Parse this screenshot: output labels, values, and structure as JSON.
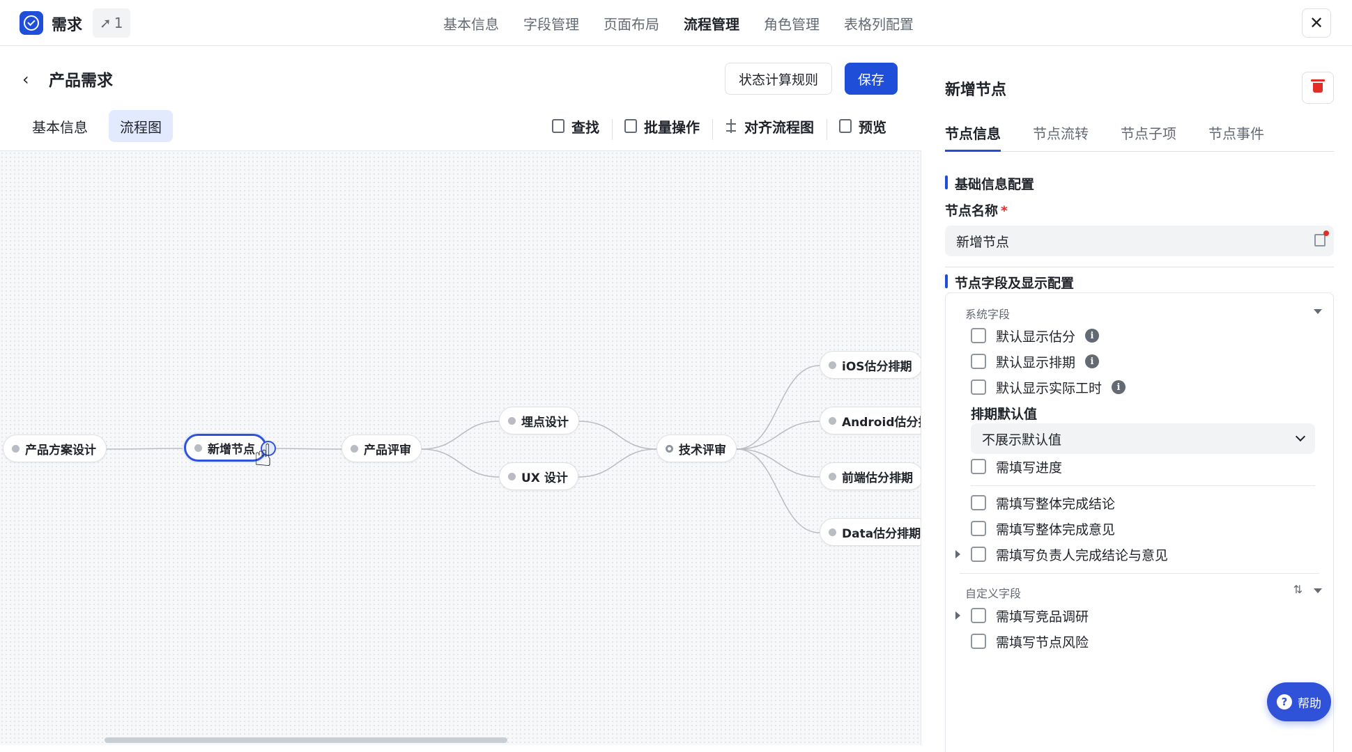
{
  "app": {
    "title": "需求",
    "badge": "1",
    "badge_icon": "pin-icon",
    "accent": "#1f4fd8"
  },
  "top_nav": [
    {
      "label": "基本信息",
      "active": false
    },
    {
      "label": "字段管理",
      "active": false
    },
    {
      "label": "页面布局",
      "active": false
    },
    {
      "label": "流程管理",
      "active": true
    },
    {
      "label": "角色管理",
      "active": false
    },
    {
      "label": "表格列配置",
      "active": false
    }
  ],
  "header": {
    "title": "产品需求",
    "rules_button": "状态计算规则",
    "save_button": "保存",
    "tabs": [
      {
        "label": "基本信息",
        "active": false
      },
      {
        "label": "流程图",
        "active": true
      }
    ],
    "toolbar": [
      {
        "label": "查找",
        "icon": "find-icon"
      },
      {
        "label": "批量操作",
        "icon": "batch-icon"
      },
      {
        "label": "对齐流程图",
        "icon": "align-icon"
      },
      {
        "label": "预览",
        "icon": "preview-icon"
      }
    ]
  },
  "flow": {
    "nodes": [
      {
        "id": "n1",
        "label": "产品方案设计"
      },
      {
        "id": "n2",
        "label": "新增节点",
        "selected": true
      },
      {
        "id": "n3",
        "label": "产品评审"
      },
      {
        "id": "n4",
        "label": "埋点设计"
      },
      {
        "id": "n5",
        "label": "UX 设计"
      },
      {
        "id": "n6",
        "label": "技术评审"
      },
      {
        "id": "n7",
        "label": "iOS估分排期"
      },
      {
        "id": "n8",
        "label": "Android估分排"
      },
      {
        "id": "n9",
        "label": "前端估分排期"
      },
      {
        "id": "n10",
        "label": "Data估分排期"
      }
    ],
    "edges": [
      [
        "n1",
        "n2"
      ],
      [
        "n2",
        "n3"
      ],
      [
        "n3",
        "n4"
      ],
      [
        "n3",
        "n5"
      ],
      [
        "n4",
        "n6"
      ],
      [
        "n5",
        "n6"
      ],
      [
        "n6",
        "n7"
      ],
      [
        "n6",
        "n8"
      ],
      [
        "n6",
        "n9"
      ],
      [
        "n6",
        "n10"
      ]
    ]
  },
  "panel": {
    "title": "新增节点",
    "tabs": [
      {
        "label": "节点信息",
        "active": true
      },
      {
        "label": "节点流转",
        "active": false
      },
      {
        "label": "节点子项",
        "active": false
      },
      {
        "label": "节点事件",
        "active": false
      }
    ],
    "basic_section": "基础信息配置",
    "name_label": "节点名称",
    "name_value": "新增节点",
    "fields_section": "节点字段及显示配置",
    "system_group": "系统字段",
    "system_fields": [
      {
        "label": "默认显示估分",
        "info": true
      },
      {
        "label": "默认显示排期",
        "info": true
      },
      {
        "label": "默认显示实际工时",
        "info": true
      }
    ],
    "schedule_default_label": "排期默认值",
    "schedule_default_value": "不展示默认值",
    "progress_field": "需填写进度",
    "conclusion_fields": [
      {
        "label": "需填写整体完成结论",
        "expandable": false
      },
      {
        "label": "需填写整体完成意见",
        "expandable": false
      },
      {
        "label": "需填写负责人完成结论与意见",
        "expandable": true
      }
    ],
    "custom_group": "自定义字段",
    "custom_fields": [
      {
        "label": "需填写竞品调研",
        "expandable": true
      },
      {
        "label": "需填写节点风险",
        "expandable": false
      }
    ]
  },
  "help": {
    "label": "帮助"
  }
}
